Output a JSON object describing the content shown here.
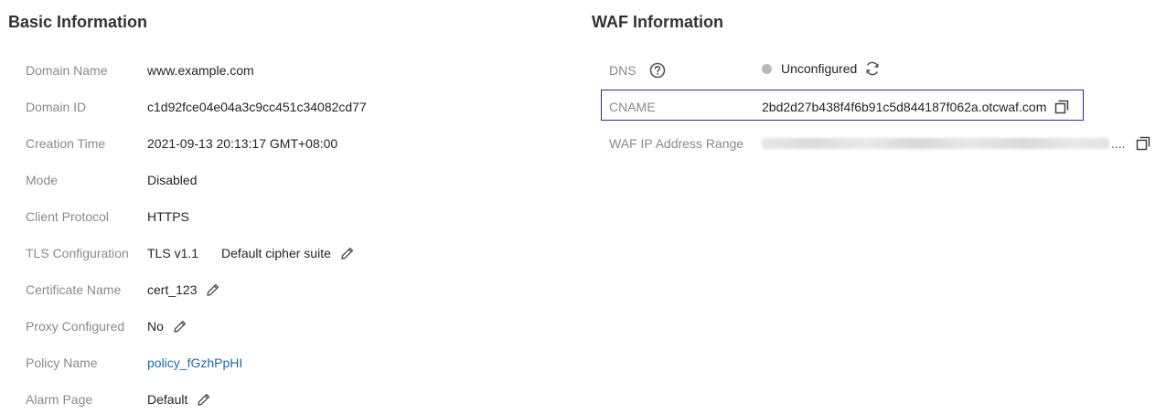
{
  "basic": {
    "title": "Basic Information",
    "domain_name": {
      "label": "Domain Name",
      "value": "www.example.com"
    },
    "domain_id": {
      "label": "Domain ID",
      "value": "c1d92fce04e04a3c9cc451c34082cd77"
    },
    "creation_time": {
      "label": "Creation Time",
      "value": "2021-09-13 20:13:17 GMT+08:00"
    },
    "mode": {
      "label": "Mode",
      "value": "Disabled"
    },
    "client_protocol": {
      "label": "Client Protocol",
      "value": "HTTPS"
    },
    "tls": {
      "label": "TLS Configuration",
      "version": "TLS v1.1",
      "cipher": "Default cipher suite"
    },
    "certificate": {
      "label": "Certificate Name",
      "value": "cert_123"
    },
    "proxy": {
      "label": "Proxy Configured",
      "value": "No"
    },
    "policy": {
      "label": "Policy Name",
      "value": "policy_fGzhPpHI"
    },
    "alarm_page": {
      "label": "Alarm Page",
      "value": "Default"
    }
  },
  "waf": {
    "title": "WAF Information",
    "dns": {
      "label": "DNS",
      "status": "Unconfigured"
    },
    "cname": {
      "label": "CNAME",
      "value": "2bd2d27b438f4f6b91c5d844187f062a.otcwaf.com"
    },
    "ip_range": {
      "label": "WAF IP Address Range",
      "ellipsis": "...."
    }
  },
  "icons": {
    "edit": "pencil-icon",
    "help": "question-circle-icon",
    "refresh": "refresh-icon",
    "copy": "copy-icon"
  },
  "colors": {
    "link": "#1e6aa8",
    "focus_border": "#262ba0",
    "status_unconfigured": "#b8b8b8"
  }
}
